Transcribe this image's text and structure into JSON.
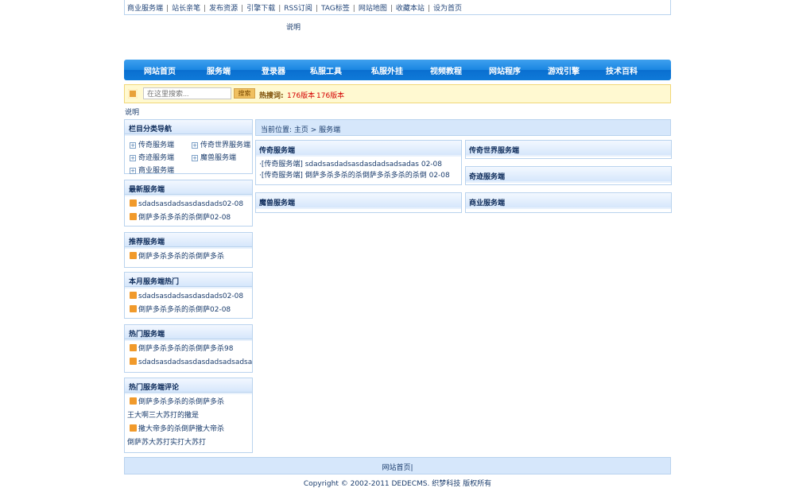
{
  "top_links": [
    "商业服务端",
    "站长亲笔",
    "发布资源",
    "引擎下载",
    "RSS订阅",
    "TAG标签",
    "网站地图",
    "收藏本站",
    "设为首页"
  ],
  "explain_text": "说明",
  "nav": [
    "网站首页",
    "服务端",
    "登录器",
    "私服工具",
    "私服外挂",
    "视频教程",
    "网站程序",
    "游戏引擎",
    "技术百科"
  ],
  "search": {
    "placeholder": "在这里搜索...",
    "button": "搜索",
    "hot_label": "热搜词:",
    "hot_words": [
      "176版本",
      "176版本"
    ]
  },
  "sidebar": {
    "category": {
      "title": "栏目分类导航",
      "items": [
        "传奇服务端",
        "传奇世界服务端",
        "奇迹服务端",
        "魔兽服务端",
        "商业服务端"
      ]
    },
    "latest": {
      "title": "最新服务端",
      "items": [
        "sdadsasdadsasdasdads02-08",
        "倒萨多杀多杀的杀倒萨02-08"
      ]
    },
    "recommend": {
      "title": "推荐服务端",
      "items": [
        "倒萨多杀多杀的杀倒萨多杀"
      ]
    },
    "month_hot": {
      "title": "本月服务端热门",
      "items": [
        "sdadsasdadsasdasdads02-08",
        "倒萨多杀多杀的杀倒萨02-08"
      ]
    },
    "hot": {
      "title": "热门服务端",
      "items": [
        "倒萨多杀多杀的杀倒萨多杀98",
        "sdadsasdadsasdasdadsadsadsadas"
      ]
    },
    "hot_comments": {
      "title": "热门服务端评论",
      "items": [
        "倒萨多杀多杀的杀倒萨多杀",
        "王大啊三大苏打的撒是",
        "撒大帝多的杀倒萨撒大帝杀",
        "倒萨苏大苏打实打大苏打"
      ]
    }
  },
  "breadcrumb": "当前位置: 主页 > 服务端",
  "content": {
    "chuanqi": {
      "title": "传奇服务端",
      "items": [
        "·[传奇服务端] sdadsasdadsasdasdadsadsadas 02-08",
        "·[传奇服务端] 倒萨多杀多杀的杀倒萨多杀多杀的杀倒 02-08"
      ]
    },
    "chuanqi_world": {
      "title": "传奇世界服务端"
    },
    "qiji": {
      "title": "奇迹服务端"
    },
    "moshou": {
      "title": "魔兽服务端"
    },
    "shangye": {
      "title": "商业服务端"
    }
  },
  "footer": {
    "links": "网站首页|",
    "copyright": "Copyright © 2002-2011 DEDECMS. 织梦科技 版权所有"
  }
}
